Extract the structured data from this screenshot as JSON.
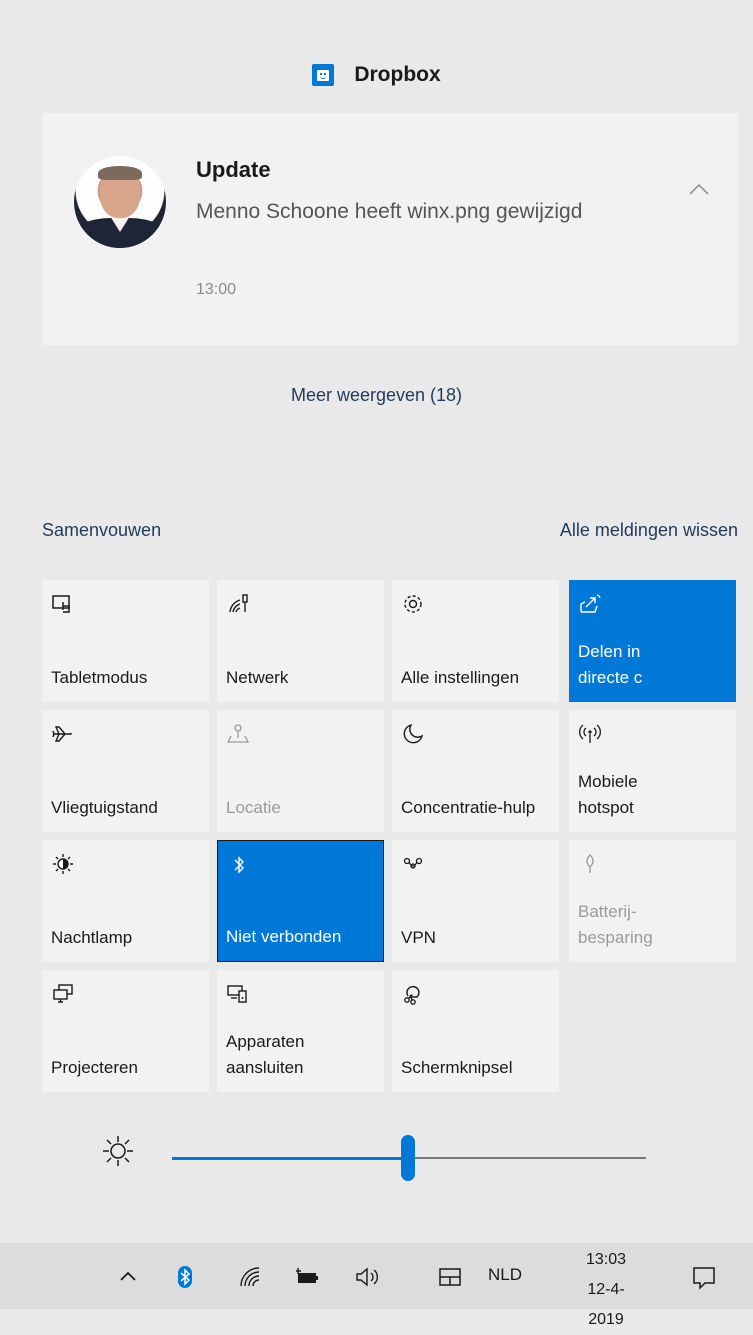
{
  "app_header": {
    "name": "Dropbox",
    "icon": "dropbox-icon",
    "accent": "#0078d7"
  },
  "notification": {
    "title": "Update",
    "body": "Menno Schoone heeft winx.png gewijzigd",
    "time": "13:00"
  },
  "more_link": "Meer weergeven (18)",
  "actions": {
    "collapse": "Samenvouwen",
    "clear_all": "Alle meldingen wissen"
  },
  "quick_actions": [
    {
      "label": "Tabletmodus",
      "icon": "tablet-mode-icon",
      "state": "off"
    },
    {
      "label": "Netwerk",
      "icon": "network-icon",
      "state": "off"
    },
    {
      "label": "Alle instellingen",
      "icon": "settings-gear-icon",
      "state": "off"
    },
    {
      "label": "Delen in directe c",
      "icon": "share-icon",
      "state": "on"
    },
    {
      "label": "Vliegtuigstand",
      "icon": "airplane-icon",
      "state": "off"
    },
    {
      "label": "Locatie",
      "icon": "location-icon",
      "state": "disabled"
    },
    {
      "label": "Concentratie-hulp",
      "icon": "moon-icon",
      "state": "off"
    },
    {
      "label": "Mobiele hotspot",
      "icon": "hotspot-icon",
      "state": "off"
    },
    {
      "label": "Nachtlamp",
      "icon": "night-light-icon",
      "state": "off"
    },
    {
      "label": "Niet verbonden",
      "icon": "bluetooth-icon",
      "state": "on"
    },
    {
      "label": "VPN",
      "icon": "vpn-icon",
      "state": "off"
    },
    {
      "label": "Batterij-besparing",
      "icon": "battery-saver-icon",
      "state": "disabled"
    },
    {
      "label": "Projecteren",
      "icon": "project-icon",
      "state": "off"
    },
    {
      "label": "Apparaten aansluiten",
      "icon": "connect-devices-icon",
      "state": "off"
    },
    {
      "label": "Schermknipsel",
      "icon": "screen-snip-icon",
      "state": "off"
    }
  ],
  "brightness": {
    "value_percent": 50,
    "icon": "brightness-icon"
  },
  "taskbar": {
    "icons": [
      "chevron-up-icon",
      "bluetooth-tray-icon",
      "wifi-icon",
      "battery-icon",
      "volume-icon",
      "touch-keyboard-icon",
      "action-center-icon"
    ],
    "language": "NLD",
    "time": "13:03",
    "date": "12-4-2019"
  }
}
